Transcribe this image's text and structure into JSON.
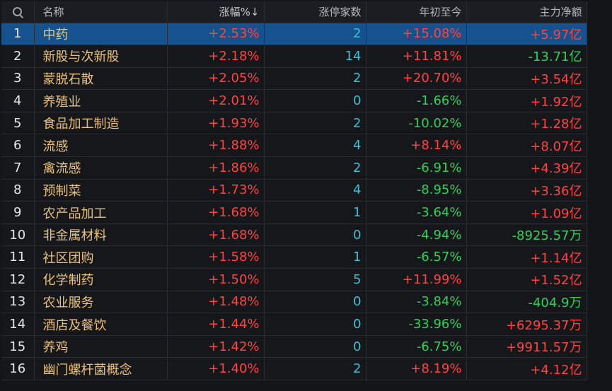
{
  "header": {
    "search_icon": "search-icon",
    "name": "名称",
    "change_pct": "涨幅%↓",
    "limit_up_count": "涨停家数",
    "ytd": "年初至今",
    "main_net": "主力净额"
  },
  "rows": [
    {
      "idx": "1",
      "name": "中药",
      "change": "+2.53%",
      "limit": "2",
      "ytd": "+15.08%",
      "net": "+5.97亿",
      "selected": true
    },
    {
      "idx": "2",
      "name": "新股与次新股",
      "change": "+2.18%",
      "limit": "14",
      "ytd": "+11.81%",
      "net": "-13.71亿"
    },
    {
      "idx": "3",
      "name": "蒙脱石散",
      "change": "+2.05%",
      "limit": "2",
      "ytd": "+20.70%",
      "net": "+3.54亿"
    },
    {
      "idx": "4",
      "name": "养殖业",
      "change": "+2.01%",
      "limit": "0",
      "ytd": "-1.66%",
      "net": "+1.92亿"
    },
    {
      "idx": "5",
      "name": "食品加工制造",
      "change": "+1.93%",
      "limit": "2",
      "ytd": "-10.02%",
      "net": "+1.28亿"
    },
    {
      "idx": "6",
      "name": "流感",
      "change": "+1.88%",
      "limit": "4",
      "ytd": "+8.14%",
      "net": "+8.07亿"
    },
    {
      "idx": "7",
      "name": "禽流感",
      "change": "+1.86%",
      "limit": "2",
      "ytd": "-6.91%",
      "net": "+4.39亿"
    },
    {
      "idx": "8",
      "name": "预制菜",
      "change": "+1.73%",
      "limit": "4",
      "ytd": "-8.95%",
      "net": "+3.36亿"
    },
    {
      "idx": "9",
      "name": "农产品加工",
      "change": "+1.68%",
      "limit": "1",
      "ytd": "-3.64%",
      "net": "+1.09亿"
    },
    {
      "idx": "10",
      "name": "非金属材料",
      "change": "+1.68%",
      "limit": "0",
      "ytd": "-4.94%",
      "net": "-8925.57万"
    },
    {
      "idx": "11",
      "name": "社区团购",
      "change": "+1.58%",
      "limit": "1",
      "ytd": "-6.57%",
      "net": "+1.14亿"
    },
    {
      "idx": "12",
      "name": "化学制药",
      "change": "+1.50%",
      "limit": "5",
      "ytd": "+11.99%",
      "net": "+1.52亿"
    },
    {
      "idx": "13",
      "name": "农业服务",
      "change": "+1.48%",
      "limit": "0",
      "ytd": "-3.84%",
      "net": "-404.9万"
    },
    {
      "idx": "14",
      "name": "酒店及餐饮",
      "change": "+1.44%",
      "limit": "0",
      "ytd": "-33.96%",
      "net": "+6295.37万"
    },
    {
      "idx": "15",
      "name": "养鸡",
      "change": "+1.42%",
      "limit": "0",
      "ytd": "-6.75%",
      "net": "+9911.57万"
    },
    {
      "idx": "16",
      "name": "幽门螺杆菌概念",
      "change": "+1.40%",
      "limit": "2",
      "ytd": "+8.19%",
      "net": "+4.12亿"
    }
  ],
  "colors": {
    "up": "#ff4242",
    "down": "#2fd05a",
    "limit": "#38c0d8",
    "name": "#e8c07a",
    "selected_row": "#16528d"
  }
}
